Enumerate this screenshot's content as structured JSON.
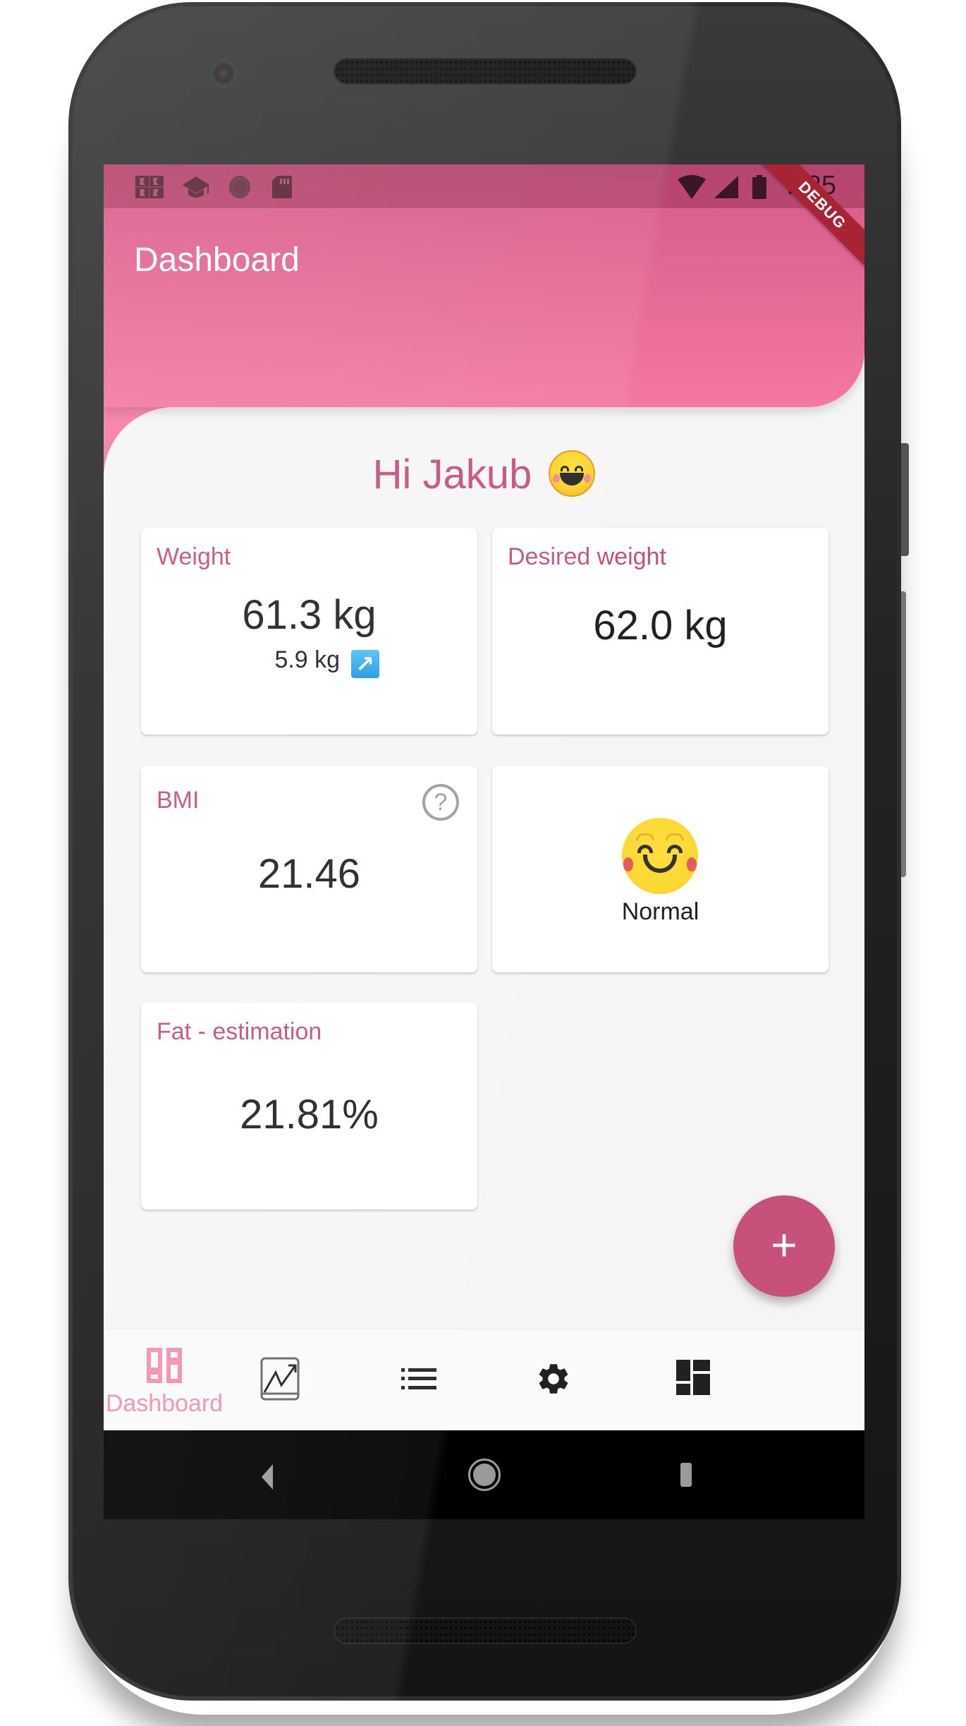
{
  "status_bar": {
    "time": "7:25",
    "left_icons": [
      "app-notification-icon",
      "school-icon",
      "sync-circle-icon",
      "sd-card-icon"
    ],
    "right_icons": [
      "wifi-icon",
      "cell-signal-icon",
      "battery-icon"
    ],
    "debug_banner": "DEBUG"
  },
  "app_bar": {
    "title": "Dashboard"
  },
  "greeting": {
    "text": "Hi Jakub",
    "emoji": "smiling-face-icon"
  },
  "cards": {
    "weight": {
      "title": "Weight",
      "value": "61.3 kg",
      "change": "5.9 kg",
      "change_icon": "↗"
    },
    "desired_weight": {
      "title": "Desired weight",
      "value": "62.0 kg"
    },
    "bmi": {
      "title": "BMI",
      "value": "21.46",
      "help_icon": "?"
    },
    "bmi_status": {
      "label": "Normal",
      "emoji": "smiling-face-with-blush-icon"
    },
    "fat": {
      "title": "Fat - estimation",
      "value": "21.81%"
    }
  },
  "fab": {
    "label": "+"
  },
  "bottom_nav": {
    "active_color": "#f48fb1",
    "items": [
      {
        "label": "Dashboard",
        "icon": "dashboard-outline-icon",
        "active": true
      },
      {
        "label": "",
        "icon": "trending-chart-icon",
        "active": false
      },
      {
        "label": "",
        "icon": "list-icon",
        "active": false
      },
      {
        "label": "",
        "icon": "settings-gear-icon",
        "active": false
      },
      {
        "label": "",
        "icon": "dashboard-icon",
        "active": false
      }
    ]
  },
  "colors": {
    "primary": "#c8517b",
    "header_top": "#d65a89",
    "header_bottom": "#f478a2",
    "background": "#f5f5f5"
  }
}
